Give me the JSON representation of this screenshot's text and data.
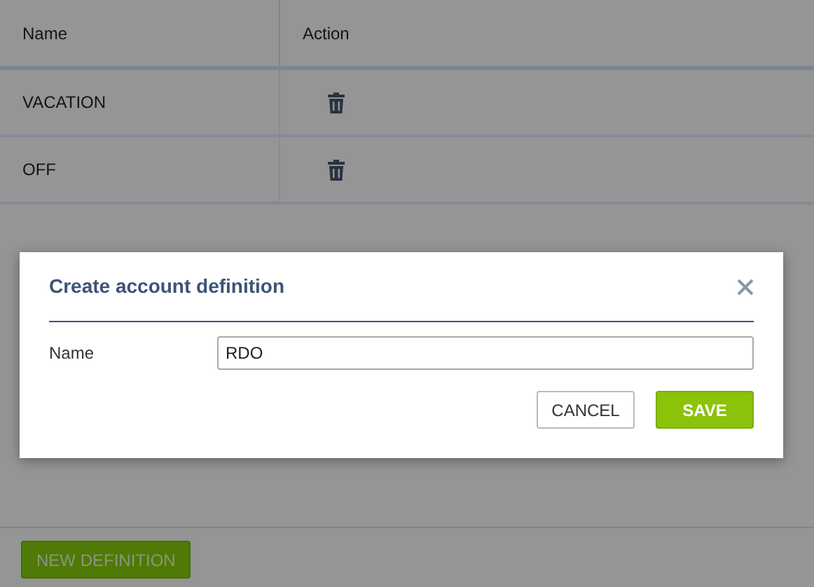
{
  "table": {
    "columns": [
      "Name",
      "Action"
    ],
    "rows": [
      {
        "name": "VACATION"
      },
      {
        "name": "OFF"
      }
    ]
  },
  "dialog": {
    "title": "Create account definition",
    "fields": [
      {
        "label": "Name",
        "value": "RDO"
      }
    ],
    "buttons": [
      {
        "label": "CANCEL",
        "kind": "secondary"
      },
      {
        "label": "SAVE",
        "kind": "primary"
      }
    ]
  },
  "footer": {
    "button": "NEW DEFINITION"
  }
}
